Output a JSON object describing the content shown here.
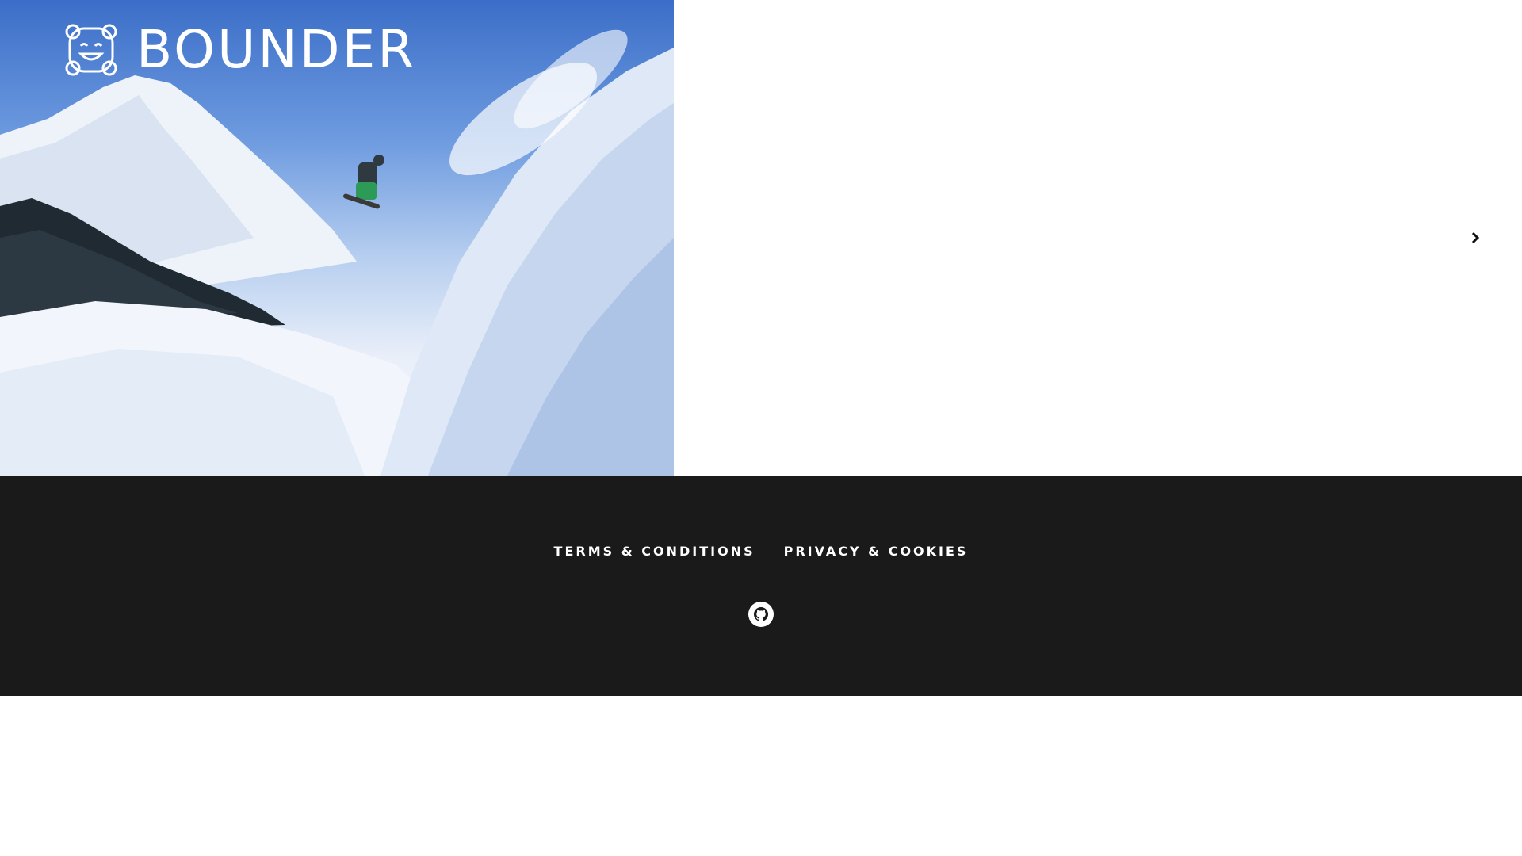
{
  "brand": {
    "name": "BOUNDER",
    "logo_icon": "smiling-face-logo-icon"
  },
  "carousel": {
    "next_icon": "chevron-right-icon"
  },
  "footer": {
    "links": [
      {
        "label": "TERMS & CONDITIONS"
      },
      {
        "label": "PRIVACY & COOKIES"
      }
    ],
    "social": {
      "github_icon": "github-icon"
    }
  },
  "colors": {
    "footer_bg": "#1a1a1a",
    "sky": "#3b6ec8",
    "snow": "#f7f9fd"
  }
}
